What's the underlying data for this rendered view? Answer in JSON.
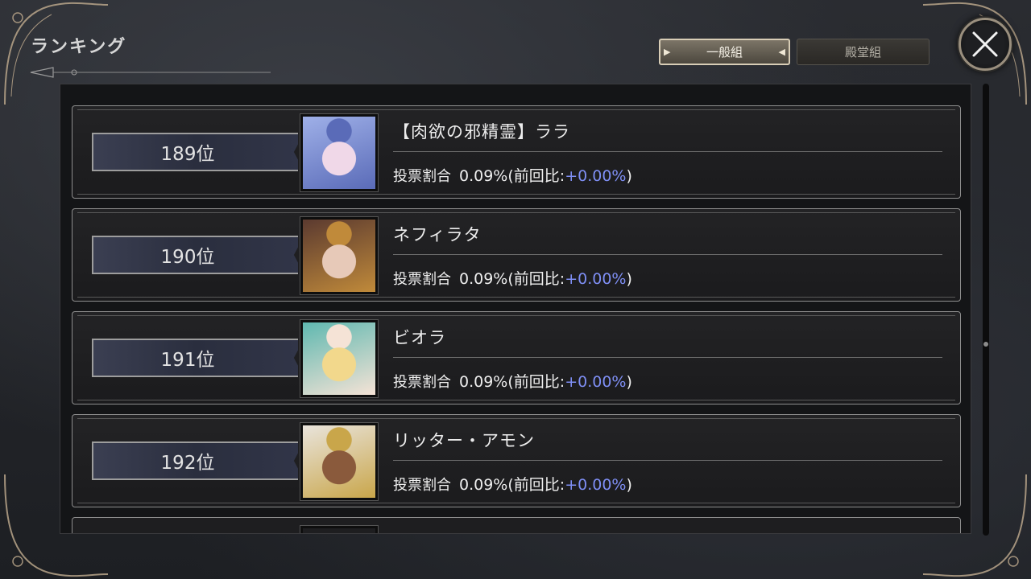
{
  "header": {
    "title": "ランキング"
  },
  "tabs": [
    {
      "label": "一般組",
      "active": true
    },
    {
      "label": "殿堂組",
      "active": false
    }
  ],
  "close_icon": "close-icon",
  "stat_label": "投票割合",
  "rows": [
    {
      "rank": "189位",
      "name": "【肉欲の邪精霊】ララ",
      "ratio": "0.09%",
      "prev_open": "(前回比:",
      "diff": "+0.00%",
      "prev_close": ")",
      "portrait_colors": [
        "#9fb0e8",
        "#f0d8e8",
        "#5a6bb8"
      ]
    },
    {
      "rank": "190位",
      "name": "ネフィラタ",
      "ratio": "0.09%",
      "prev_open": "(前回比:",
      "diff": "+0.00%",
      "prev_close": ")",
      "portrait_colors": [
        "#5b3a30",
        "#e7c9b8",
        "#c08a3a"
      ]
    },
    {
      "rank": "191位",
      "name": "ビオラ",
      "ratio": "0.09%",
      "prev_open": "(前回比:",
      "diff": "+0.00%",
      "prev_close": ")",
      "portrait_colors": [
        "#5fb8b0",
        "#f2d88c",
        "#f5e3d6"
      ]
    },
    {
      "rank": "192位",
      "name": "リッター・アモン",
      "ratio": "0.09%",
      "prev_open": "(前回比:",
      "diff": "+0.00%",
      "prev_close": ")",
      "portrait_colors": [
        "#e9e4dc",
        "#8a5a3c",
        "#c9a64a"
      ]
    }
  ],
  "colors": {
    "accent_diff": "#7f8ff5",
    "frame": "#b9a58a"
  }
}
